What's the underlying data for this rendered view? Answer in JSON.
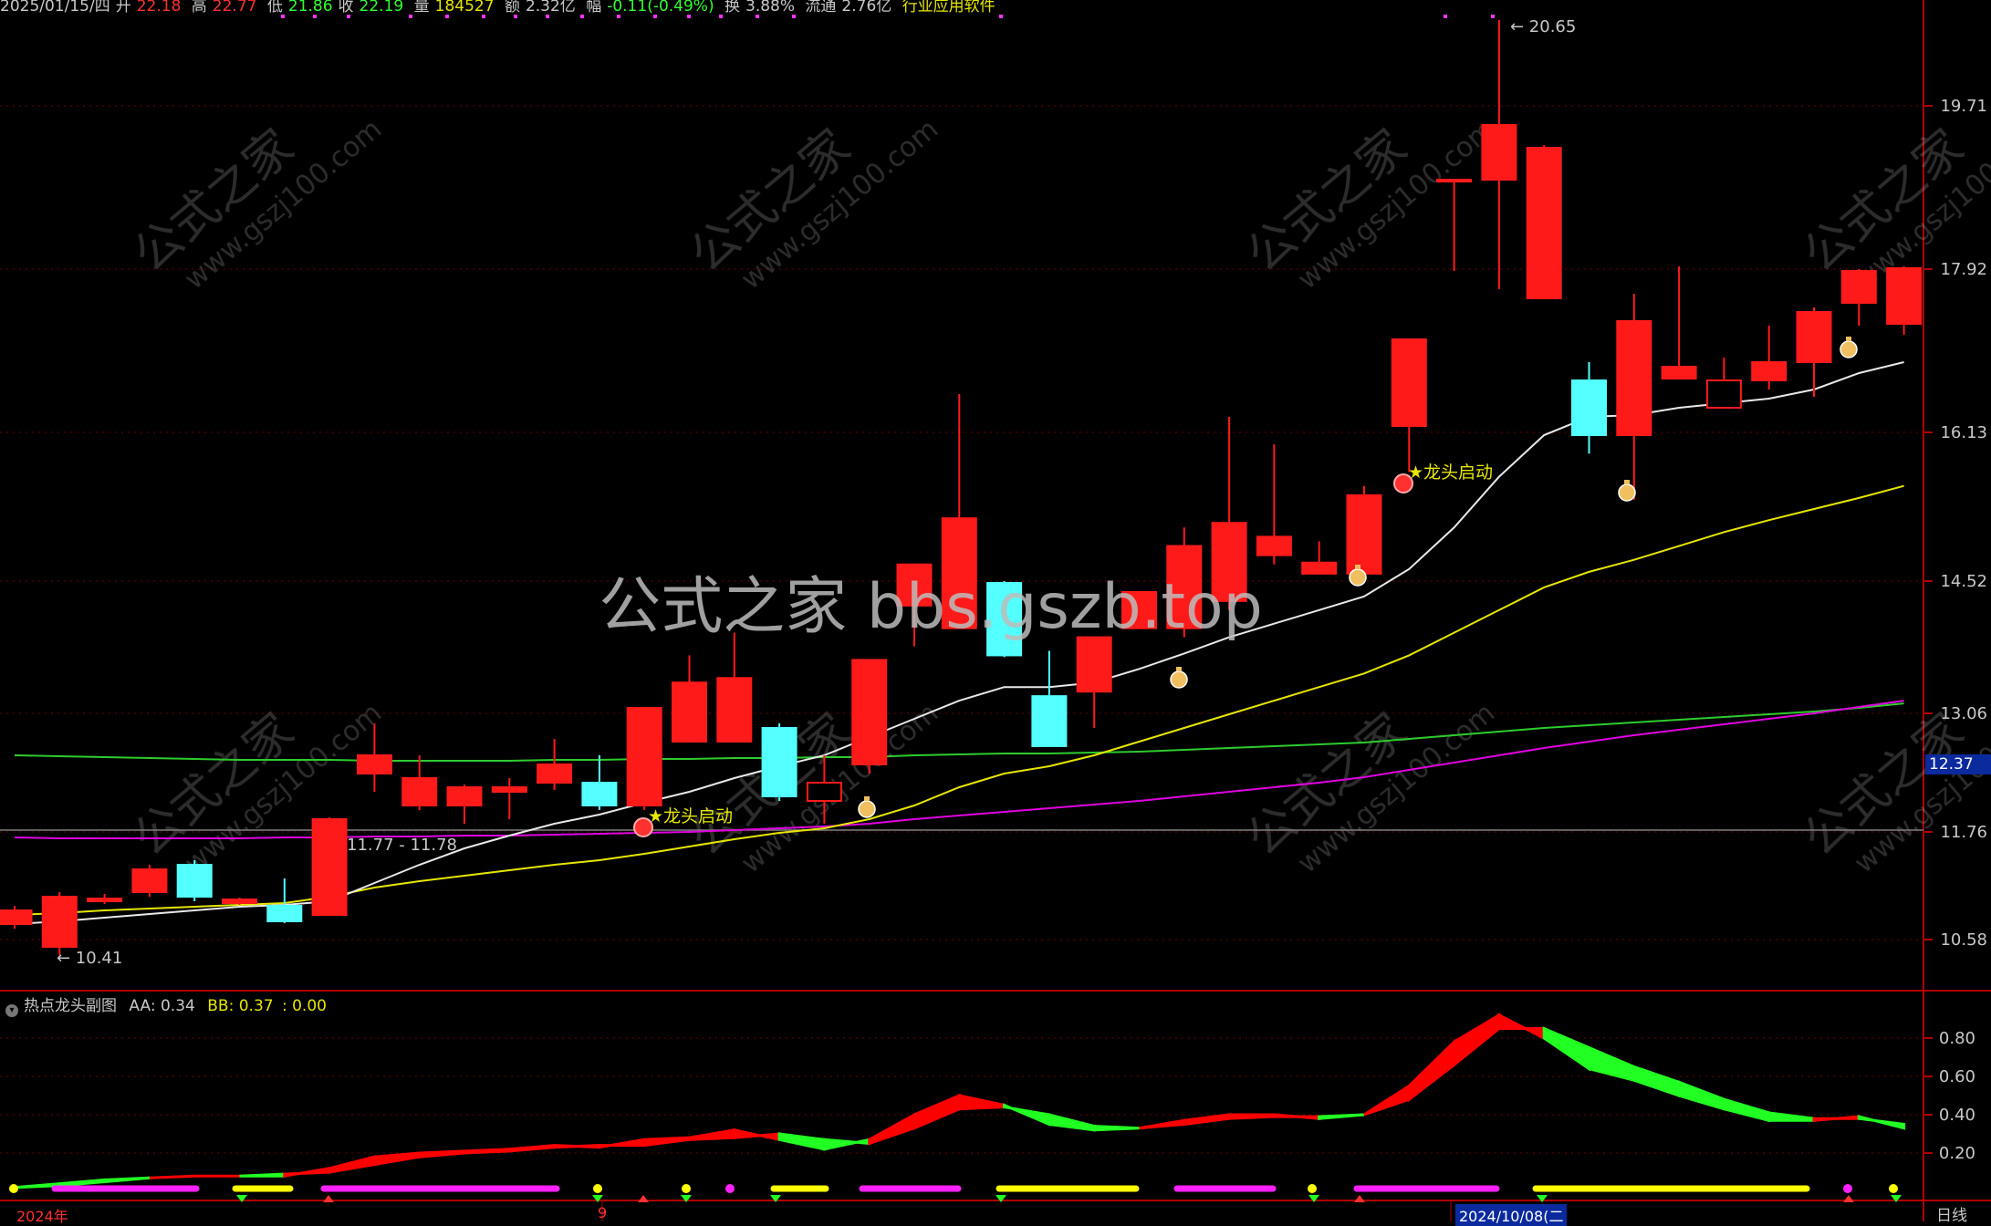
{
  "infobar": {
    "date": "2025/01/15/四",
    "open_label": "开",
    "open": "22.18",
    "high_label": "高",
    "high": "22.77",
    "low_label": "低",
    "low": "21.86",
    "close_label": "收",
    "close": "22.19",
    "volume_label": "量",
    "volume": "184527",
    "amount_label": "额",
    "amount": "2.32亿",
    "change_label": "幅",
    "change": "-0.11(-0.49%)",
    "turnover_label": "换",
    "turnover": "3.88%",
    "float_label": "流通",
    "float": "2.76亿",
    "sector": "行业应用软件"
  },
  "colors": {
    "up": "#ff1a1a",
    "down": "#54ffff",
    "ma_white": "#e8e8e8",
    "ma_yellow": "#e6e600",
    "ma_green": "#2ecc2e",
    "ma_magenta": "#e000e0",
    "axis_red": "#b00000",
    "grid_red": "#6a0000",
    "band_red": "#ff0000",
    "band_green": "#22ff22"
  },
  "price_axis": {
    "ticks": [
      "19.71",
      "17.92",
      "16.13",
      "14.52",
      "13.06",
      "11.76",
      "10.58"
    ],
    "current_price": "12.37"
  },
  "annotations": {
    "high_marker": "20.65",
    "low_marker": "10.41",
    "range_label": "11.77 - 11.78",
    "signal_label_1": "★龙头启动",
    "signal_label_2": "★龙头启动"
  },
  "watermarks": {
    "center": "公式之家 bbs.gszb.top",
    "diag_cn": "公式之家",
    "diag_url": "www.gszj100.com"
  },
  "indicator_panel": {
    "name": "热点龙头副图",
    "aa_label": "AA:",
    "aa": "0.34",
    "bb_label": "BB:",
    "bb": "0.37",
    "extra": ": 0.00",
    "ticks": [
      "0.80",
      "0.60",
      "0.40",
      "0.20"
    ]
  },
  "dates": {
    "left": "2024年",
    "mid": "9",
    "right": "2024/10/08(二"
  },
  "period": "日线",
  "chart_data": {
    "type": "candlestick",
    "price_range": [
      9.9,
      21.0
    ],
    "candles": [
      {
        "o": 10.75,
        "c": 10.9,
        "h": 10.95,
        "l": 10.7
      },
      {
        "o": 10.5,
        "c": 11.05,
        "h": 11.1,
        "l": 10.41
      },
      {
        "o": 11.0,
        "c": 11.03,
        "h": 11.08,
        "l": 10.97
      },
      {
        "o": 11.1,
        "c": 11.35,
        "h": 11.4,
        "l": 11.05
      },
      {
        "o": 11.4,
        "c": 11.05,
        "h": 11.45,
        "l": 11.0
      },
      {
        "o": 10.98,
        "c": 11.02,
        "h": 11.04,
        "l": 10.96
      },
      {
        "o": 10.95,
        "c": 10.78,
        "h": 11.25,
        "l": 10.76
      },
      {
        "o": 10.85,
        "c": 11.9,
        "h": 11.92,
        "l": 10.85
      },
      {
        "o": 12.4,
        "c": 12.6,
        "h": 12.95,
        "l": 12.2
      },
      {
        "o": 12.05,
        "c": 12.35,
        "h": 12.6,
        "l": 12.0
      },
      {
        "o": 12.05,
        "c": 12.25,
        "h": 12.28,
        "l": 11.85
      },
      {
        "o": 12.2,
        "c": 12.25,
        "h": 12.35,
        "l": 11.9
      },
      {
        "o": 12.3,
        "c": 12.5,
        "h": 12.78,
        "l": 12.22
      },
      {
        "o": 12.3,
        "c": 12.05,
        "h": 12.6,
        "l": 12.0
      },
      {
        "o": 12.05,
        "c": 13.12,
        "h": 13.12,
        "l": 12.0
      },
      {
        "o": 12.75,
        "c": 13.4,
        "h": 13.7,
        "l": 12.75
      },
      {
        "o": 12.75,
        "c": 13.45,
        "h": 13.95,
        "l": 12.75
      },
      {
        "o": 12.9,
        "c": 12.15,
        "h": 12.95,
        "l": 12.1
      },
      {
        "o": 12.1,
        "c": 12.3,
        "h": 12.6,
        "l": 11.85
      },
      {
        "o": 12.5,
        "c": 13.65,
        "h": 13.65,
        "l": 12.4
      },
      {
        "o": 14.25,
        "c": 14.7,
        "h": 14.7,
        "l": 13.8
      },
      {
        "o": 14.0,
        "c": 15.2,
        "h": 16.55,
        "l": 14.0
      },
      {
        "o": 14.5,
        "c": 13.7,
        "h": 14.52,
        "l": 13.68
      },
      {
        "o": 13.25,
        "c": 12.7,
        "h": 13.75,
        "l": 12.7
      },
      {
        "o": 13.3,
        "c": 13.9,
        "h": 13.9,
        "l": 12.9
      },
      {
        "o": 14.0,
        "c": 14.4,
        "h": 14.4,
        "l": 14.0
      },
      {
        "o": 14.0,
        "c": 14.9,
        "h": 15.1,
        "l": 13.9
      },
      {
        "o": 14.3,
        "c": 15.15,
        "h": 16.3,
        "l": 14.2
      },
      {
        "o": 14.8,
        "c": 15.0,
        "h": 16.0,
        "l": 14.7
      },
      {
        "o": 14.6,
        "c": 14.72,
        "h": 14.95,
        "l": 14.6
      },
      {
        "o": 14.6,
        "c": 15.45,
        "h": 15.55,
        "l": 14.6
      },
      {
        "o": 16.2,
        "c": 17.15,
        "h": 17.15,
        "l": 15.7
      },
      {
        "o": 18.9,
        "c": 18.9,
        "h": 18.9,
        "l": 17.9
      },
      {
        "o": 18.9,
        "c": 19.5,
        "h": 20.65,
        "l": 17.7
      },
      {
        "o": 17.6,
        "c": 19.25,
        "h": 19.28,
        "l": 17.6
      },
      {
        "o": 16.7,
        "c": 16.1,
        "h": 16.9,
        "l": 15.9
      },
      {
        "o": 16.1,
        "c": 17.35,
        "h": 17.65,
        "l": 15.4
      },
      {
        "o": 16.72,
        "c": 16.85,
        "h": 17.95,
        "l": 16.72
      },
      {
        "o": 16.4,
        "c": 16.7,
        "h": 16.95,
        "l": 16.4
      },
      {
        "o": 16.7,
        "c": 16.9,
        "h": 17.3,
        "l": 16.6
      },
      {
        "o": 16.9,
        "c": 17.45,
        "h": 17.5,
        "l": 16.52
      },
      {
        "o": 17.55,
        "c": 17.9,
        "h": 17.92,
        "l": 17.3
      },
      {
        "o": 17.32,
        "c": 17.93,
        "h": 17.95,
        "l": 17.2
      }
    ],
    "ma_white": [
      10.75,
      10.78,
      10.82,
      10.86,
      10.9,
      10.94,
      10.96,
      11.0,
      11.2,
      11.4,
      11.58,
      11.72,
      11.85,
      11.95,
      12.08,
      12.2,
      12.35,
      12.48,
      12.6,
      12.8,
      13.0,
      13.2,
      13.35,
      13.35,
      13.4,
      13.55,
      13.72,
      13.9,
      14.05,
      14.2,
      14.35,
      14.65,
      15.1,
      15.65,
      16.1,
      16.3,
      16.32,
      16.4,
      16.45,
      16.5,
      16.6,
      16.78,
      16.9
    ],
    "ma_yellow": [
      10.85,
      10.87,
      10.9,
      10.92,
      10.94,
      10.96,
      10.98,
      11.05,
      11.15,
      11.22,
      11.28,
      11.34,
      11.4,
      11.45,
      11.52,
      11.6,
      11.68,
      11.75,
      11.8,
      11.9,
      12.05,
      12.25,
      12.4,
      12.48,
      12.6,
      12.75,
      12.9,
      13.05,
      13.2,
      13.35,
      13.5,
      13.7,
      13.95,
      14.2,
      14.45,
      14.62,
      14.75,
      14.9,
      15.05,
      15.18,
      15.3,
      15.42,
      15.55
    ],
    "ma_green": [
      12.6,
      12.59,
      12.58,
      12.57,
      12.56,
      12.55,
      12.55,
      12.55,
      12.54,
      12.54,
      12.54,
      12.54,
      12.55,
      12.55,
      12.56,
      12.56,
      12.57,
      12.57,
      12.58,
      12.58,
      12.6,
      12.61,
      12.62,
      12.62,
      12.63,
      12.64,
      12.66,
      12.68,
      12.7,
      12.72,
      12.74,
      12.78,
      12.82,
      12.86,
      12.9,
      12.93,
      12.96,
      12.99,
      13.02,
      13.05,
      13.08,
      13.12,
      13.17
    ],
    "ma_magenta": [
      11.7,
      11.69,
      11.69,
      11.69,
      11.69,
      11.69,
      11.7,
      11.7,
      11.71,
      11.71,
      11.72,
      11.72,
      11.73,
      11.74,
      11.75,
      11.76,
      11.78,
      11.8,
      11.82,
      11.85,
      11.9,
      11.94,
      11.98,
      12.02,
      12.06,
      12.1,
      12.15,
      12.2,
      12.25,
      12.3,
      12.36,
      12.44,
      12.52,
      12.6,
      12.68,
      12.75,
      12.82,
      12.88,
      12.94,
      13.0,
      13.06,
      13.13,
      13.2
    ],
    "hline": 11.78,
    "indicator": {
      "range": [
        0.05,
        1.0
      ],
      "aa": [
        0.02,
        0.03,
        0.05,
        0.07,
        0.08,
        0.08,
        0.08,
        0.12,
        0.18,
        0.2,
        0.21,
        0.22,
        0.24,
        0.23,
        0.27,
        0.28,
        0.32,
        0.27,
        0.22,
        0.27,
        0.4,
        0.5,
        0.45,
        0.35,
        0.32,
        0.33,
        0.37,
        0.4,
        0.4,
        0.38,
        0.4,
        0.55,
        0.78,
        0.92,
        0.8,
        0.64,
        0.58,
        0.5,
        0.43,
        0.37,
        0.37,
        0.39,
        0.33
      ],
      "bb": [
        0.02,
        0.04,
        0.06,
        0.07,
        0.08,
        0.08,
        0.09,
        0.1,
        0.14,
        0.18,
        0.2,
        0.21,
        0.23,
        0.24,
        0.24,
        0.27,
        0.28,
        0.3,
        0.27,
        0.25,
        0.33,
        0.43,
        0.44,
        0.4,
        0.34,
        0.33,
        0.35,
        0.38,
        0.39,
        0.39,
        0.4,
        0.48,
        0.66,
        0.85,
        0.85,
        0.75,
        0.65,
        0.57,
        0.48,
        0.41,
        0.38,
        0.38,
        0.35
      ]
    }
  }
}
